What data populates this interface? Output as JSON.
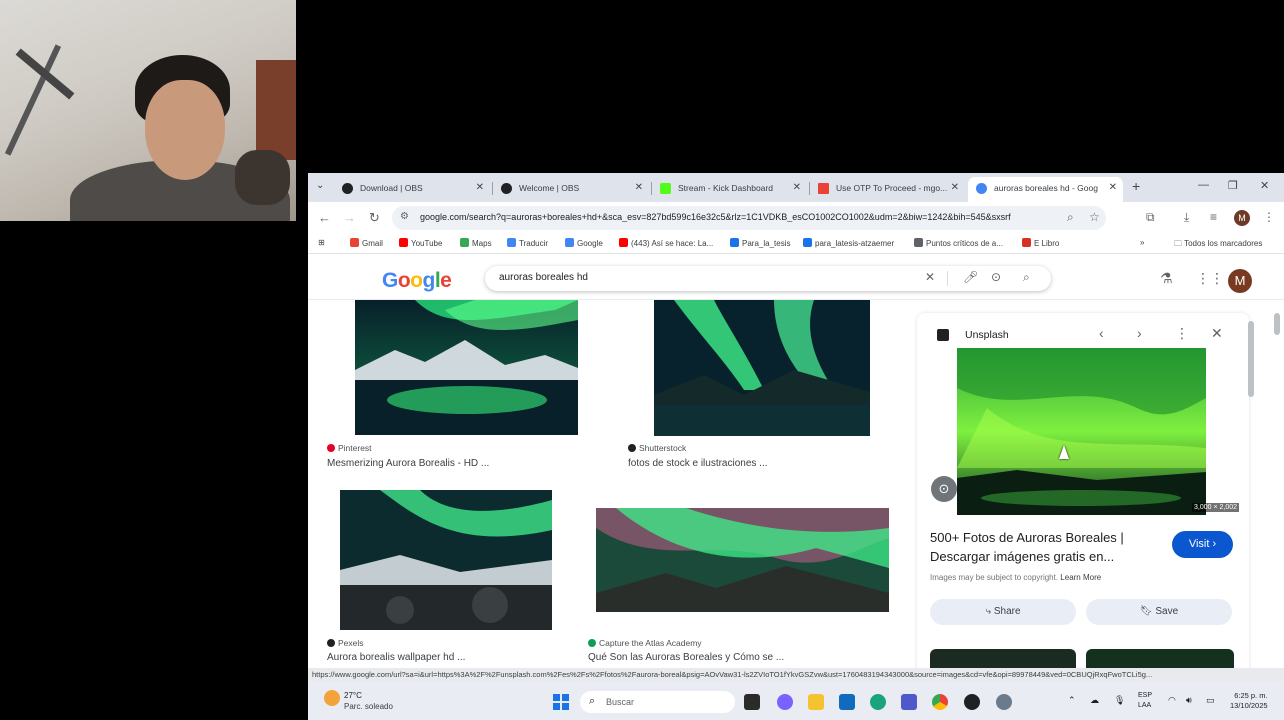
{
  "browser": {
    "tabs": [
      {
        "title": "Download | OBS",
        "color": "#202124"
      },
      {
        "title": "Welcome | OBS",
        "color": "#202124"
      },
      {
        "title": "Stream - Kick Dashboard",
        "color": "#53fc18"
      },
      {
        "title": "Use OTP To Proceed - mgo...",
        "color": "#ea4335"
      },
      {
        "title": "auroras boreales hd - Goog",
        "color": "#4285f4"
      }
    ],
    "url": "google.com/search?q=auroras+boreales+hd+&sca_esv=827bd599c16e32c5&rlz=1C1VDKB_esCO1002CO1002&udm=2&biw=1242&bih=545&sxsrf",
    "bookmarks": [
      {
        "label": "Gmail",
        "color": "#ea4335"
      },
      {
        "label": "YouTube",
        "color": "#ff0000"
      },
      {
        "label": "Maps",
        "color": "#34a853"
      },
      {
        "label": "Traducir",
        "color": "#4285f4"
      },
      {
        "label": "Google",
        "color": "#4285f4"
      },
      {
        "label": "(443) Así se hace: La...",
        "color": "#ff0000"
      },
      {
        "label": "Para_la_tesis",
        "color": "#1a73e8"
      },
      {
        "label": "para_latesis-atzaemer",
        "color": "#1a73e8"
      },
      {
        "label": "Puntos críticos de a...",
        "color": "#5f6368"
      },
      {
        "label": "E Libro",
        "color": "#d93025"
      }
    ],
    "all_bookmarks_label": "Todos los marcadores",
    "profile_initial": "M",
    "status_url": "https://www.google.com/url?sa=i&url=https%3A%2F%2Funsplash.com%2Fes%2Fs%2Ffotos%2Faurora-boreal&psig=AOvVaw31-ls2ZVIoTO1fYkvGSZvw&ust=1760483194343000&source=images&cd=vfe&opi=89978449&ved=0CBUQjRxqFwoTCLi5g..."
  },
  "google": {
    "logo": [
      "G",
      "o",
      "o",
      "g",
      "l",
      "e"
    ],
    "logo_colors": [
      "#4285f4",
      "#ea4335",
      "#fbbc05",
      "#4285f4",
      "#34a853",
      "#ea4335"
    ],
    "query": "auroras boreales hd",
    "avatar_initial": "M"
  },
  "results": [
    {
      "source": "Pinterest",
      "source_color": "#e60023",
      "title": "Mesmerizing Aurora Borealis - HD ..."
    },
    {
      "source": "Shutterstock",
      "source_color": "#202124",
      "title": "fotos de stock e ilustraciones ..."
    },
    {
      "source": "Pexels",
      "source_color": "#202124",
      "title": "Aurora borealis wallpaper hd ..."
    },
    {
      "source": "Capture the Atlas Academy",
      "source_color": "#0f9d58",
      "title": "Qué Son las Auroras Boreales y Cómo se ..."
    }
  ],
  "side_panel": {
    "source": "Unsplash",
    "dimensions": "3,000 × 2,002",
    "title": "500+ Fotos de Auroras Boreales | Descargar imágenes gratis en...",
    "visit_label": "Visit ›",
    "copyright": "Images may be subject to copyright.",
    "learn_more": "Learn More",
    "share_label": "Share",
    "save_label": "Save"
  },
  "taskbar": {
    "temperature": "27°C",
    "weather": "Parc. soleado",
    "search_placeholder": "Buscar",
    "lang_line1": "ESP",
    "lang_line2": "LAA",
    "time": "6:25 p. m.",
    "date": "13/10/2025"
  }
}
